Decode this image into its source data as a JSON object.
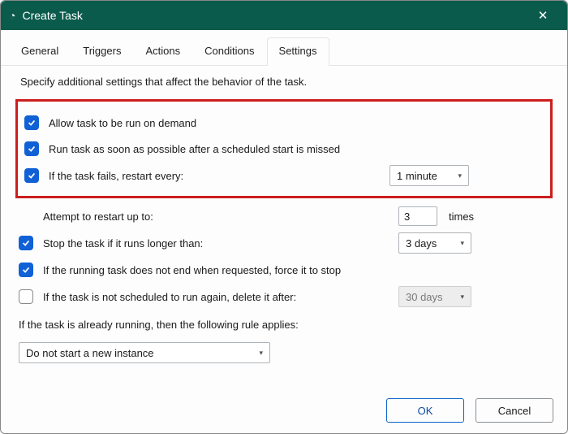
{
  "window": {
    "title": "Create Task"
  },
  "tabs": {
    "general": "General",
    "triggers": "Triggers",
    "actions": "Actions",
    "conditions": "Conditions",
    "settings": "Settings"
  },
  "intro": "Specify additional settings that affect the behavior of the task.",
  "options": {
    "allow_on_demand": "Allow task to be run on demand",
    "run_asap": "Run task as soon as possible after a scheduled start is missed",
    "restart_every": "If the task fails, restart every:",
    "restart_interval": "1 minute",
    "attempt_label": "Attempt to restart up to:",
    "attempt_count": "3",
    "attempt_suffix": "times",
    "stop_if_longer": "Stop the task if it runs longer than:",
    "stop_duration": "3 days",
    "force_stop": "If the running task does not end when requested, force it to stop",
    "delete_after": "If the task is not scheduled to run again, delete it after:",
    "delete_duration": "30 days",
    "rule_label": "If the task is already running, then the following rule applies:",
    "rule_value": "Do not start a new instance"
  },
  "buttons": {
    "ok": "OK",
    "cancel": "Cancel"
  }
}
